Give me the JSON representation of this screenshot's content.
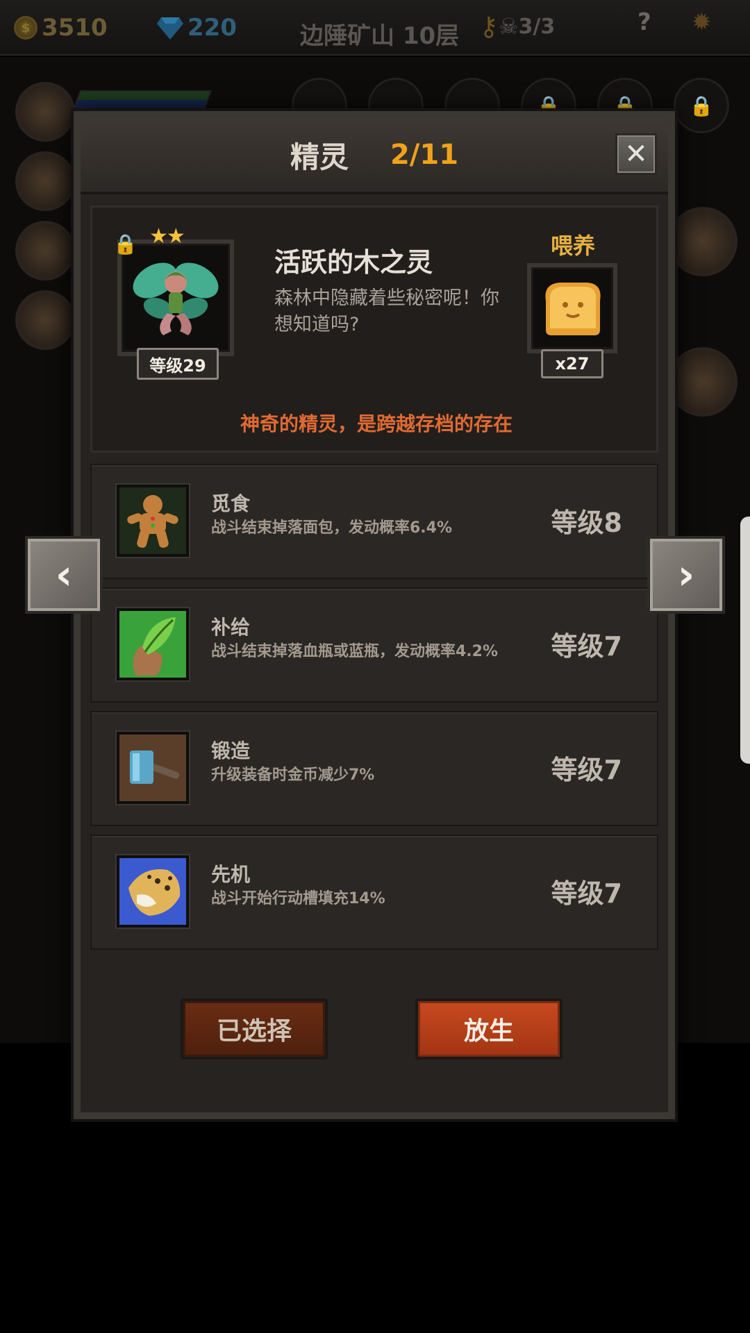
{
  "topbar": {
    "gold": "3510",
    "gems": "220",
    "location": "边陲矿山 10层",
    "skulls": "3/3",
    "icons": [
      "coin-icon",
      "gem-icon",
      "key-icon",
      "skull-icon",
      "help-icon",
      "gear-icon"
    ]
  },
  "modal": {
    "title": "精灵",
    "count": "2/11",
    "close_icon": "close-icon"
  },
  "spirit": {
    "name": "活跃的木之灵",
    "description": "森林中隐藏着些秘密呢！你想知道吗?",
    "level": "等级29",
    "stars": 2,
    "locked": true,
    "feed_label": "喂养",
    "feed_count": "x27",
    "notice": "神奇的精灵，是跨越存档的存在"
  },
  "skills": [
    {
      "name": "觅食",
      "desc": "战斗结束掉落面包，发动概率6.4%",
      "level": "等级8",
      "icon": "gingerbread-icon"
    },
    {
      "name": "补给",
      "desc": "战斗结束掉落血瓶或蓝瓶，发动概率4.2%",
      "level": "等级7",
      "icon": "leaf-hand-icon"
    },
    {
      "name": "锻造",
      "desc": "升级装备时金币减少7%",
      "level": "等级7",
      "icon": "hammer-icon"
    },
    {
      "name": "先机",
      "desc": "战斗开始行动槽填充14%",
      "level": "等级7",
      "icon": "leopard-icon"
    }
  ],
  "buttons": {
    "selected": "已选择",
    "release": "放生"
  },
  "colors": {
    "count": "#f0a21a",
    "feed_label": "#e6b040",
    "notice": "#e16a32",
    "release_button": "#c84a20"
  }
}
